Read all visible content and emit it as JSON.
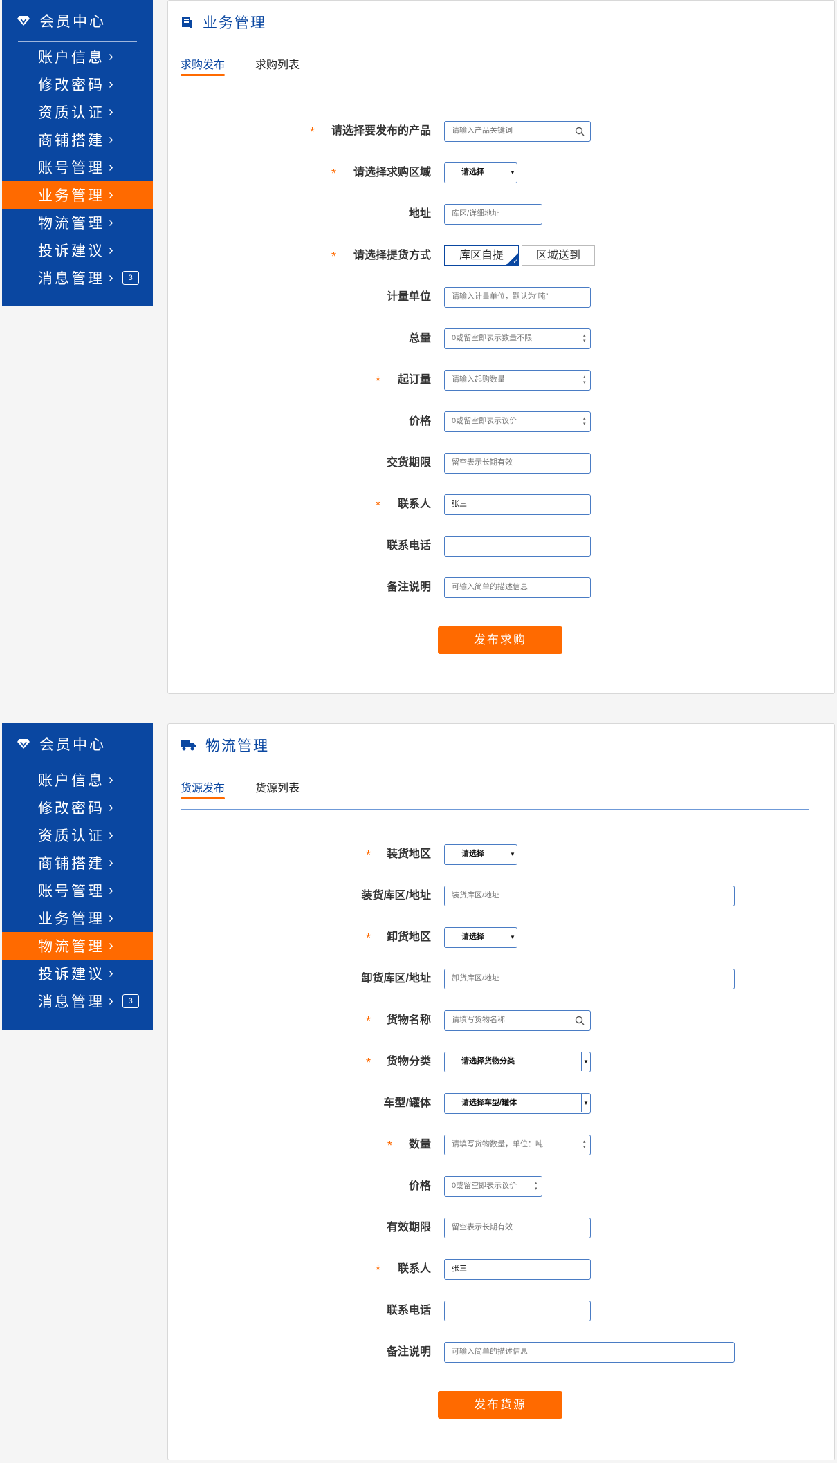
{
  "sidebar": {
    "title": "会员中心",
    "items": [
      "账户信息",
      "修改密码",
      "资质认证",
      "商铺搭建",
      "账号管理",
      "业务管理",
      "物流管理",
      "投诉建议",
      "消息管理"
    ],
    "badge": "3"
  },
  "section1": {
    "title": "业务管理",
    "tabs": [
      "求购发布",
      "求购列表"
    ],
    "fields": {
      "product": {
        "label": "请选择要发布的产品",
        "placeholder": "请输入产品关键词"
      },
      "region": {
        "label": "请选择求购区域",
        "value": "请选择"
      },
      "address": {
        "label": "地址",
        "placeholder": "库区/详细地址"
      },
      "delivery": {
        "label": "请选择提货方式",
        "option_on": "库区自提",
        "option_off": "区域送到"
      },
      "unit": {
        "label": "计量单位",
        "placeholder": "请输入计量单位，默认为“吨”"
      },
      "total": {
        "label": "总量",
        "placeholder": "0或留空即表示数量不限"
      },
      "min_order": {
        "label": "起订量",
        "placeholder": "请输入起购数量"
      },
      "price": {
        "label": "价格",
        "placeholder": "0或留空即表示议价"
      },
      "deadline": {
        "label": "交货期限",
        "placeholder": "留空表示长期有效"
      },
      "contact": {
        "label": "联系人",
        "value": "张三"
      },
      "phone": {
        "label": "联系电话",
        "value": ""
      },
      "remark": {
        "label": "备注说明",
        "placeholder": "可输入简单的描述信息"
      }
    },
    "submit": "发布求购"
  },
  "section2": {
    "title": "物流管理",
    "tabs": [
      "货源发布",
      "货源列表"
    ],
    "fields": {
      "load_region": {
        "label": "装货地区",
        "value": "请选择"
      },
      "load_addr": {
        "label": "装货库区/地址",
        "placeholder": "装货库区/地址"
      },
      "unload_region": {
        "label": "卸货地区",
        "value": "请选择"
      },
      "unload_addr": {
        "label": "卸货库区/地址",
        "placeholder": "卸货库区/地址"
      },
      "goods_name": {
        "label": "货物名称",
        "placeholder": "请填写货物名称"
      },
      "goods_cat": {
        "label": "货物分类",
        "value": "请选择货物分类"
      },
      "vehicle": {
        "label": "车型/罐体",
        "value": "请选择车型/罐体"
      },
      "qty": {
        "label": "数量",
        "placeholder": "请填写货物数量，单位：吨"
      },
      "price": {
        "label": "价格",
        "placeholder": "0或留空即表示议价"
      },
      "valid": {
        "label": "有效期限",
        "placeholder": "留空表示长期有效"
      },
      "contact": {
        "label": "联系人",
        "value": "张三"
      },
      "phone": {
        "label": "联系电话",
        "value": ""
      },
      "remark": {
        "label": "备注说明",
        "placeholder": "可输入简单的描述信息"
      }
    },
    "submit": "发布货源"
  },
  "colors": {
    "brand_blue": "#0a47a1",
    "accent_orange": "#ff6a00"
  }
}
